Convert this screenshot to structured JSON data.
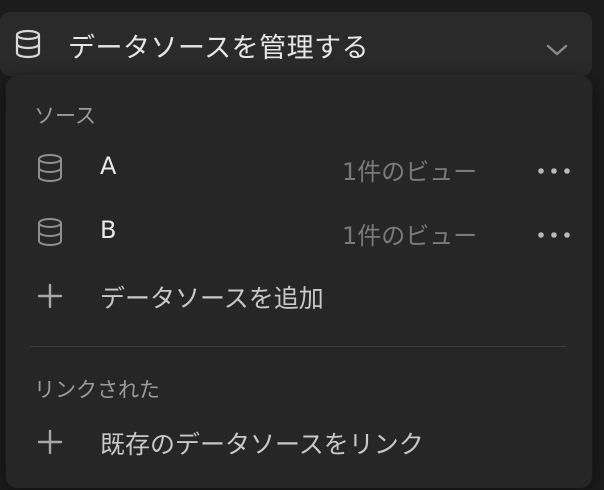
{
  "trigger": {
    "title": "データソースを管理する",
    "icon": "database-icon",
    "chevron_icon": "chevron-down-icon"
  },
  "menu": {
    "sources_label": "ソース",
    "sources": [
      {
        "name": "A",
        "views": "1件のビュー",
        "icon": "database-icon",
        "more_icon": "more-icon"
      },
      {
        "name": "B",
        "views": "1件のビュー",
        "icon": "database-icon",
        "more_icon": "more-icon"
      }
    ],
    "add_source_label": "データソースを追加",
    "linked_label": "リンクされた",
    "link_existing_label": "既存のデータソースをリンク"
  },
  "colors": {
    "background": "#1c1c1c",
    "trigger_bg": "#2a2a2a",
    "menu_bg": "#262626",
    "primary_text": "#e8e8e8",
    "muted_text": "#7a7a7a"
  }
}
